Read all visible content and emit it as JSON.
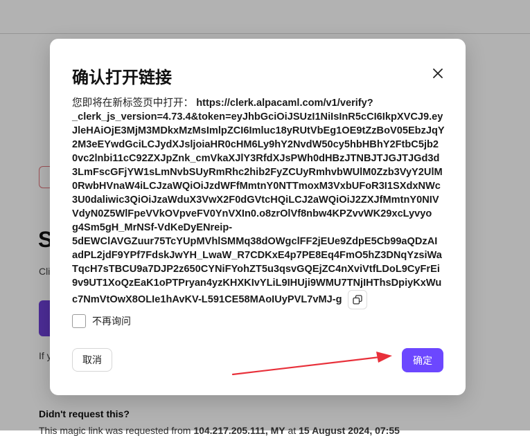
{
  "background": {
    "heading_fragment": "S",
    "text_fragment_1": "Cli",
    "text_fragment_2": "If y",
    "didnt_request": "Didn't request this?",
    "magic_link_prefix": "This magic link was requested from ",
    "magic_link_ip": "104.217.205.111, MY",
    "magic_link_mid": " at ",
    "magic_link_date": "15 August 2024, 07:55"
  },
  "dialog": {
    "title": "确认打开链接",
    "message_prefix": "您即将在新标签页中打开：",
    "url_lines": [
      "https://clerk.alpacaml.com/v1/verify?",
      "_clerk_js_version=4.73.4&token=eyJhbGciOiJSUzI1NiIsInR5cCI6IkpXVCJ9.ey",
      "JleHAiOjE3MjM3MDkxMzMsImlpZCI6Imluc18yRUtVbEg1OE9tZzBoV05EbzJqY",
      "2M3eEYwdGciLCJydXJsljoiaHR0cHM6Ly9hY2NvdW50cy5hbHBhY2FtbC5jb2",
      "0vc2lnbi11cC92ZXJpZnk_cmVkaXJlY3RfdXJsPWh0dHBzJTNBJTJGJTJGd3d",
      "3LmFscGFjYW1sLmNvbSUyRmRhc2hib2FyZCUyRmhvbWUlM0Zzb3VyY2UlM",
      "0RwbHVnaW4iLCJzaWQiOiJzdWFfMmtnY0NTTmoxM3VxbUFoR3I1SXdxNWc",
      "3U0daliwic3QiOiJzaWduX3VwX2F0dGVtcHQiLCJ2aWQiOiJ2ZXJfMmtnY0NIV",
      "VdyN0Z5WlFpeVVkOVpveFV0YnVXIn0.o8zrOlVf8nbw4KPZvvWK29xcLyvyo",
      "g4Sm5gH_MrNSf-VdKeDyENreip-",
      "5dEWClAVGZuur75TcYUpMVhlSMMq38dOWgclFF2jEUe9ZdpE5Cb99aQDzAI",
      "adPL2jdF9YPf7FdskJwYH_LwaW_R7CDKxE4p7PE8Eq4FmO5hZ3DNqYzsiWa",
      "TqcH7sTBCU9a7DJP2z650CYNiFYohZT5u3qsvGQEjZC4nXviVtfLDoL9CyFrEi",
      "9v9UT1XoQzEaK1oPTPryan4yzKHXKIvYLiL9IHUji9WMU7TNjIHThsDpiyKxWu",
      "c7NmVtOwX8OLIe1hAvKV-L591CE58MAoIUyPVL7vMJ-g"
    ],
    "checkbox_label": "不再询问",
    "cancel_label": "取消",
    "confirm_label": "确定"
  },
  "colors": {
    "accent": "#6c47ff",
    "arrow": "#e8303a"
  },
  "icons": {
    "close": "close-icon",
    "copy": "copy-icon"
  }
}
